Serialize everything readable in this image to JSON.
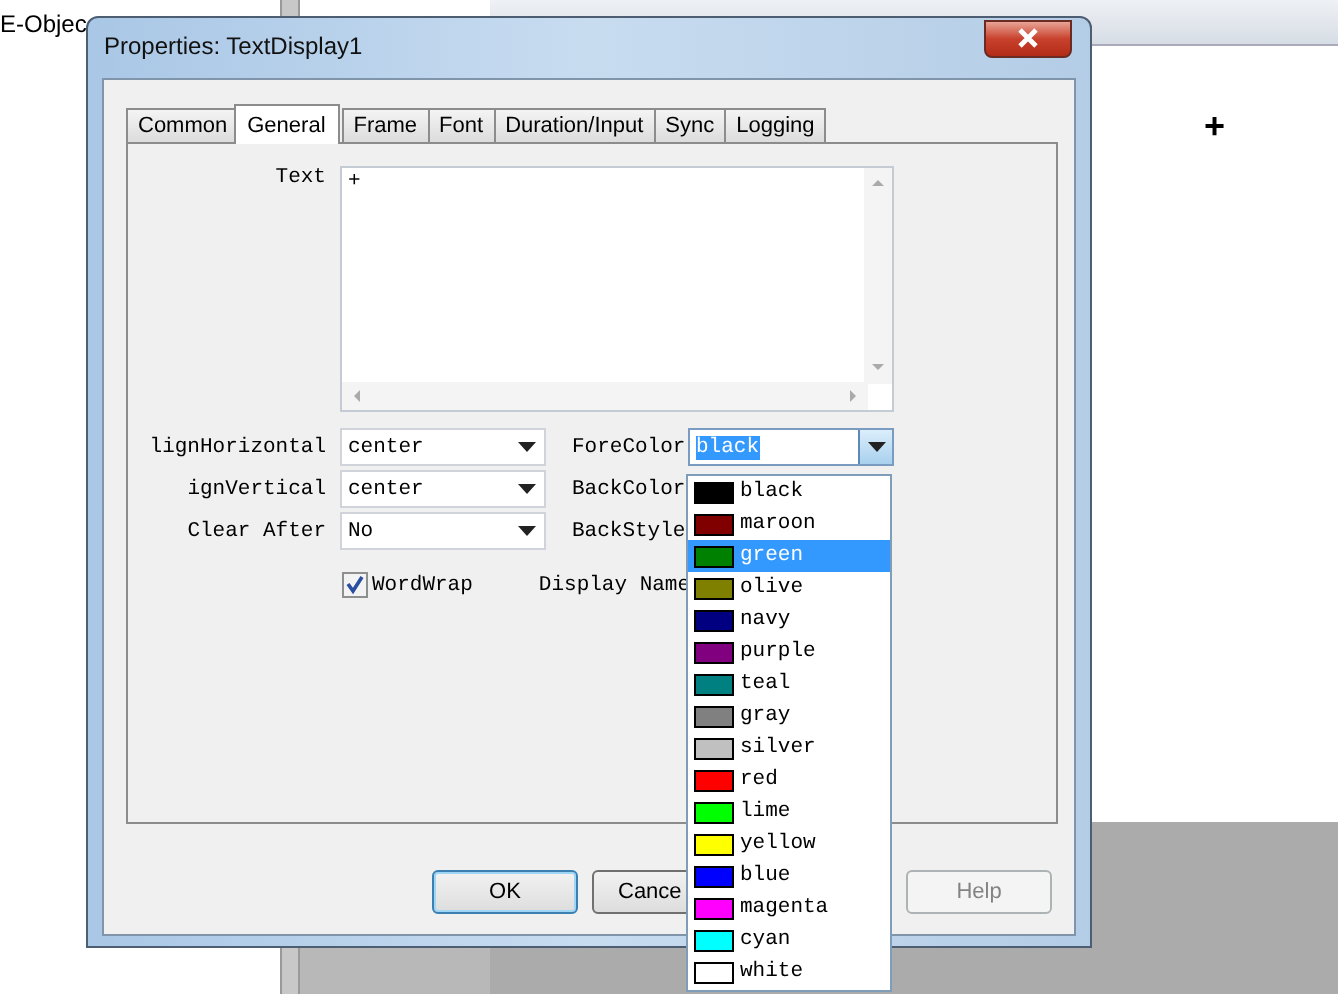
{
  "background": {
    "panel_text": "E-Objec",
    "canvas_text": "+"
  },
  "dialog": {
    "title": "Properties: TextDisplay1",
    "tabs": [
      {
        "label": "Common",
        "selected": false
      },
      {
        "label": "General",
        "selected": true
      },
      {
        "label": "Frame",
        "selected": false
      },
      {
        "label": "Font",
        "selected": false
      },
      {
        "label": "Duration/Input",
        "selected": false
      },
      {
        "label": "Sync",
        "selected": false
      },
      {
        "label": "Logging",
        "selected": false
      }
    ],
    "text_field": {
      "label": "Text",
      "value": "+"
    },
    "left_fields": [
      {
        "label": "lignHorizontal",
        "value": "center"
      },
      {
        "label": "ignVertical",
        "value": "center"
      },
      {
        "label": "Clear After",
        "value": "No"
      }
    ],
    "right_labels": [
      "ForeColor",
      "BackColor",
      "BackStyle"
    ],
    "fore_color": {
      "value": "black"
    },
    "word_wrap": {
      "label": "WordWrap",
      "checked": true
    },
    "display_name": {
      "label": "Display Name"
    },
    "color_list": [
      {
        "label": "black",
        "color": "#000000",
        "selected": false
      },
      {
        "label": "maroon",
        "color": "#800000",
        "selected": false
      },
      {
        "label": "green",
        "color": "#008000",
        "selected": true
      },
      {
        "label": "olive",
        "color": "#808000",
        "selected": false
      },
      {
        "label": "navy",
        "color": "#000080",
        "selected": false
      },
      {
        "label": "purple",
        "color": "#800080",
        "selected": false
      },
      {
        "label": "teal",
        "color": "#008080",
        "selected": false
      },
      {
        "label": "gray",
        "color": "#808080",
        "selected": false
      },
      {
        "label": "silver",
        "color": "#c0c0c0",
        "selected": false
      },
      {
        "label": "red",
        "color": "#ff0000",
        "selected": false
      },
      {
        "label": "lime",
        "color": "#00ff00",
        "selected": false
      },
      {
        "label": "yellow",
        "color": "#ffff00",
        "selected": false
      },
      {
        "label": "blue",
        "color": "#0000ff",
        "selected": false
      },
      {
        "label": "magenta",
        "color": "#ff00ff",
        "selected": false
      },
      {
        "label": "cyan",
        "color": "#00ffff",
        "selected": false
      },
      {
        "label": "white",
        "color": "#ffffff",
        "selected": false
      }
    ],
    "buttons": [
      {
        "label": "OK",
        "kind": "default"
      },
      {
        "label": "Cance",
        "kind": "normal"
      },
      {
        "label": "Help",
        "kind": "disabled"
      }
    ]
  }
}
